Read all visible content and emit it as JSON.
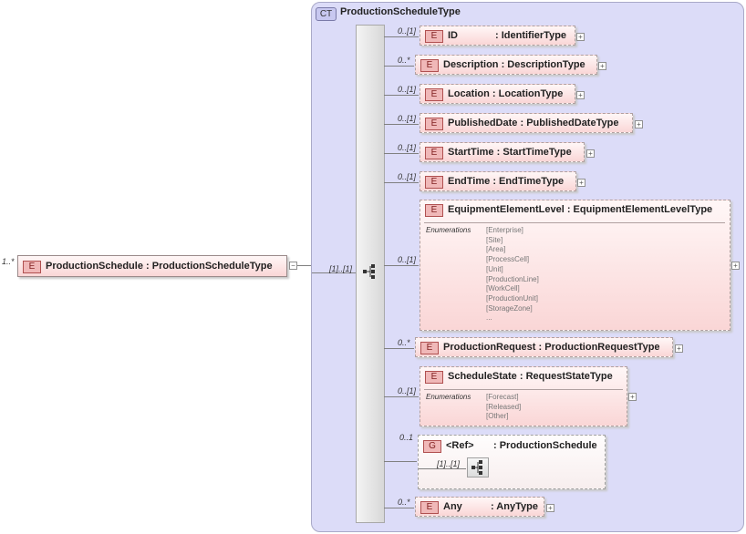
{
  "root": {
    "cardinality": "1..*",
    "badge": "E",
    "name": "ProductionSchedule",
    "sep": ":",
    "type": "ProductionScheduleType"
  },
  "complex_type": {
    "badge": "CT",
    "name": "ProductionScheduleType"
  },
  "sequence": {
    "cardinality": "[1]..[1]"
  },
  "elements": [
    {
      "cardinality": "0..[1]",
      "badge": "E",
      "name": "ID",
      "type": ": IdentifierType"
    },
    {
      "cardinality": "0..*",
      "badge": "E",
      "name": "Description",
      "type": ": DescriptionType"
    },
    {
      "cardinality": "0..[1]",
      "badge": "E",
      "name": "Location",
      "type": ": LocationType"
    },
    {
      "cardinality": "0..[1]",
      "badge": "E",
      "name": "PublishedDate",
      "type": ": PublishedDateType"
    },
    {
      "cardinality": "0..[1]",
      "badge": "E",
      "name": "StartTime",
      "type": ": StartTimeType"
    },
    {
      "cardinality": "0..[1]",
      "badge": "E",
      "name": "EndTime",
      "type": ": EndTimeType"
    }
  ],
  "equipment": {
    "cardinality": "0..[1]",
    "badge": "E",
    "name": "EquipmentElementLevel",
    "type": ": EquipmentElementLevelType",
    "enum_label": "Enumerations",
    "enums": [
      "[Enterprise]",
      "[Site]",
      "[Area]",
      "[ProcessCell]",
      "[Unit]",
      "[ProductionLine]",
      "[WorkCell]",
      "[ProductionUnit]",
      "[StorageZone]",
      "..."
    ]
  },
  "production_request": {
    "cardinality": "0..*",
    "badge": "E",
    "name": "ProductionRequest",
    "type": ": ProductionRequestType"
  },
  "schedule_state": {
    "cardinality": "0..[1]",
    "badge": "E",
    "name": "ScheduleState",
    "type": ": RequestStateType",
    "enum_label": "Enumerations",
    "enums": [
      "[Forecast]",
      "[Released]",
      "[Other]"
    ]
  },
  "group": {
    "cardinality": "0..1",
    "badge": "G",
    "name": "<Ref>",
    "type": ": ProductionSchedule",
    "inner_cardinality": "[1]..[1]"
  },
  "any": {
    "cardinality": "0..*",
    "badge": "E",
    "name": "Any",
    "type": ": AnyType"
  },
  "plus_glyph": "+",
  "minus_glyph": "−"
}
